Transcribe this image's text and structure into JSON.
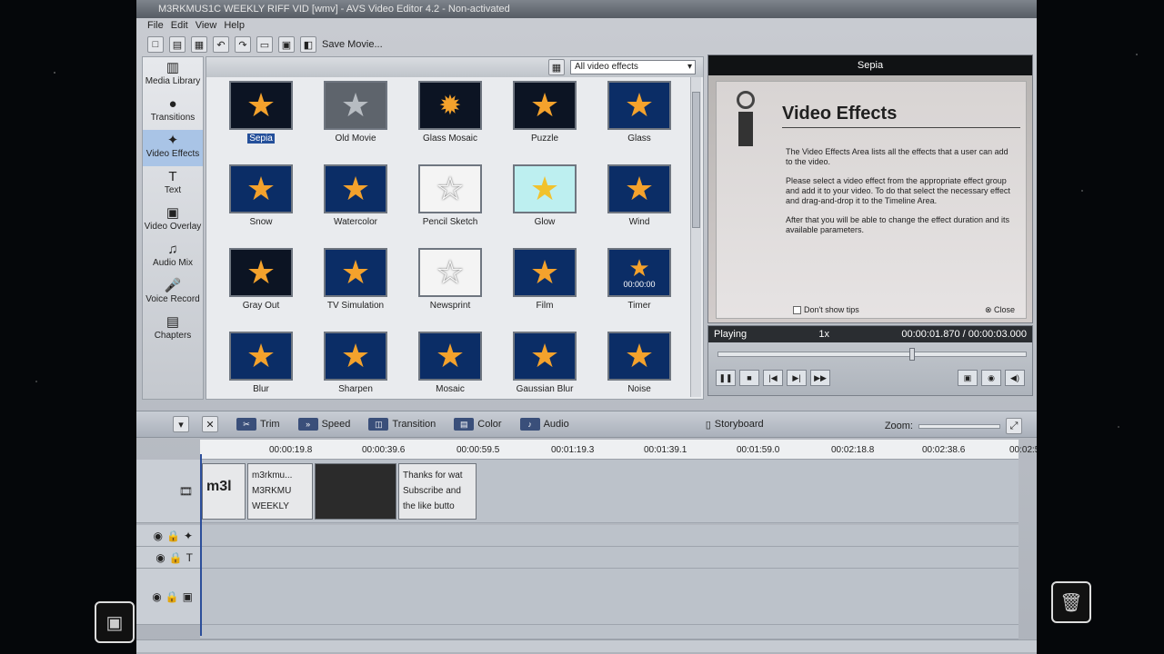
{
  "window": {
    "title": "M3RKMUS1C WEEKLY RIFF VID [wmv] - AVS Video Editor 4.2 - Non-activated"
  },
  "menu": [
    "File",
    "Edit",
    "View",
    "Help"
  ],
  "toolbar": {
    "save_movie": "Save Movie..."
  },
  "nav": [
    {
      "label": "Media Library",
      "icon": "film-icon"
    },
    {
      "label": "Transitions",
      "icon": "transition-icon"
    },
    {
      "label": "Video Effects",
      "icon": "effects-icon"
    },
    {
      "label": "Text",
      "icon": "text-icon"
    },
    {
      "label": "Video Overlay",
      "icon": "overlay-icon"
    },
    {
      "label": "Audio Mix",
      "icon": "music-icon"
    },
    {
      "label": "Voice Record",
      "icon": "microphone-icon"
    },
    {
      "label": "Chapters",
      "icon": "chapters-icon"
    }
  ],
  "effects": {
    "filter": "All video effects",
    "items": [
      "Sepia",
      "Old Movie",
      "Glass Mosaic",
      "Puzzle",
      "Glass",
      "Snow",
      "Watercolor",
      "Pencil Sketch",
      "Glow",
      "Wind",
      "Gray Out",
      "TV Simulation",
      "Newsprint",
      "Film",
      "Timer",
      "Blur",
      "Sharpen",
      "Mosaic",
      "Gaussian Blur",
      "Noise"
    ],
    "selected": "Sepia",
    "timer_text": "00:00:00"
  },
  "tip": {
    "header": "Sepia",
    "title": "Video Effects",
    "paragraphs": [
      "The Video Effects Area lists all the effects that a user can add to the video.",
      "Please select a video effect from the appropriate effect group and add it to your video. To do that select the necessary effect and drag-and-drop it to the Timeline Area.",
      "After that you will be able to change the effect duration and its available parameters."
    ],
    "dont_show": "Don't show tips",
    "close": "Close"
  },
  "player": {
    "status": "Playing",
    "speed": "1x",
    "time": "00:00:01.870 / 00:00:03.000",
    "progress": 0.62
  },
  "timeline": {
    "buttons": [
      "Trim",
      "Speed",
      "Transition",
      "Color",
      "Audio"
    ],
    "storyboard": "Storyboard",
    "zoom_label": "Zoom:",
    "ruler": [
      "00:00:19.8",
      "00:00:39.6",
      "00:00:59.5",
      "00:01:19.3",
      "00:01:39.1",
      "00:01:59.0",
      "00:02:18.8",
      "00:02:38.6",
      "00:02:5"
    ],
    "clips": {
      "c1": "m3l",
      "c2a": "m3rkmu...",
      "c2b": "M3RKMU",
      "c2c": "WEEKLY",
      "c4a": "Thanks for wat",
      "c4b": "Subscribe and",
      "c4c": "the like butto"
    }
  }
}
